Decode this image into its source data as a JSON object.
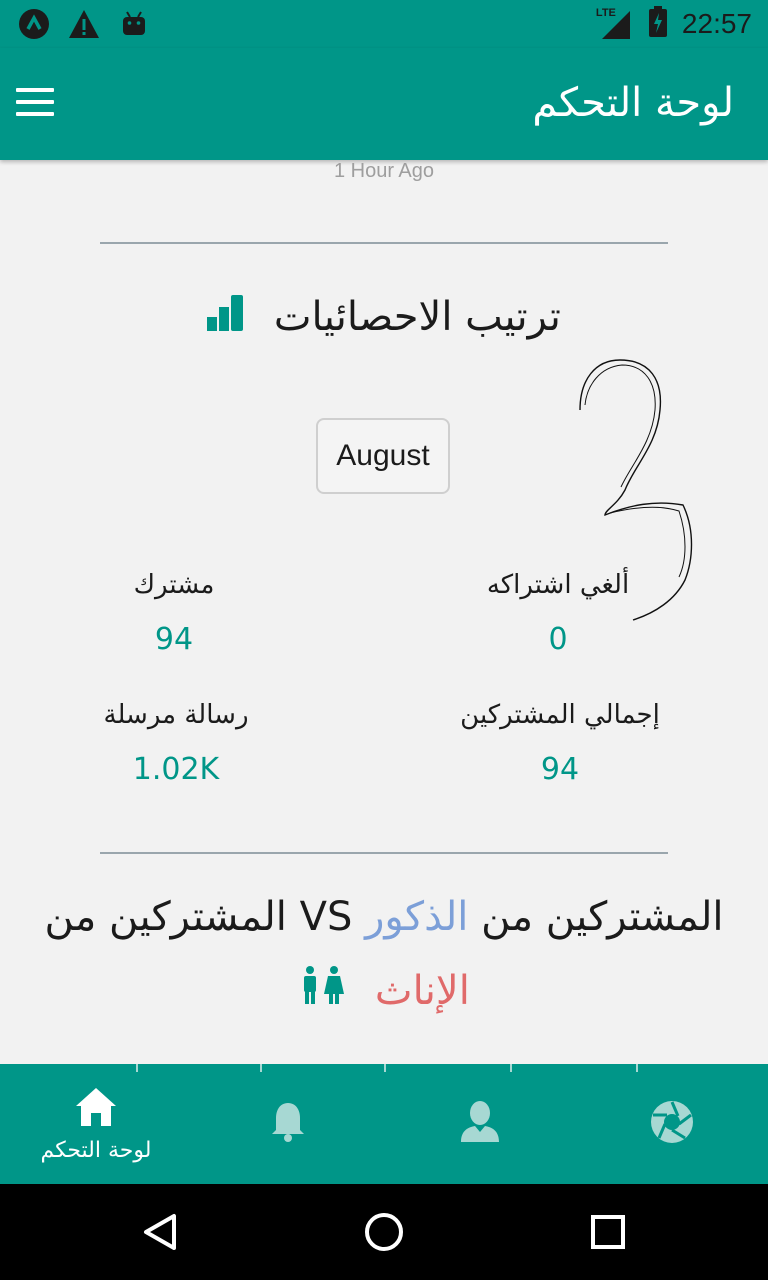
{
  "status_bar": {
    "network": "LTE",
    "time": "22:57"
  },
  "app_bar": {
    "title": "لوحة التحكم"
  },
  "main": {
    "timestamp": "1 Hour Ago",
    "stats_section_title": "ترتيب الاحصائيات",
    "month_button": "August",
    "stats": [
      {
        "label": "ألغي اشتراكه",
        "value": "0"
      },
      {
        "label": "مشترك",
        "value": "94"
      },
      {
        "label": "إجمالي المشتركين",
        "value": "94"
      },
      {
        "label": "رسالة مرسلة",
        "value": "1.02K"
      }
    ],
    "compare": {
      "part1": "المشتركين من ",
      "male": "الذكور",
      "part2": " VS المشتركين من",
      "female": "الإناث"
    }
  },
  "bottom_nav": {
    "items": [
      {
        "label": "لوحة التحكم",
        "icon": "home-icon",
        "active": true
      },
      {
        "label": "",
        "icon": "bell-icon",
        "active": false
      },
      {
        "label": "",
        "icon": "user-icon",
        "active": false
      },
      {
        "label": "",
        "icon": "aperture-icon",
        "active": false
      }
    ]
  },
  "colors": {
    "primary": "#009688",
    "male": "#7c9fd8",
    "female": "#e06a6a",
    "value": "#009688"
  }
}
